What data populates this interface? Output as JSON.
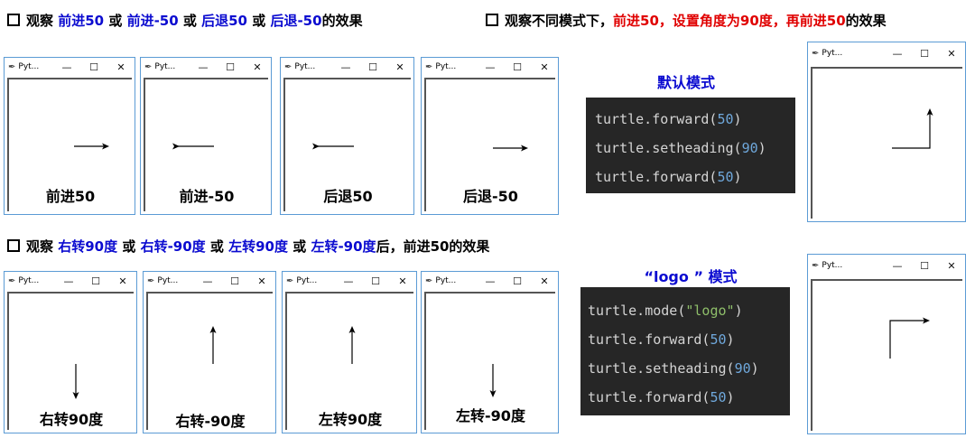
{
  "headings": {
    "h1": [
      "观察 ",
      "前进50",
      " 或 ",
      "前进-50",
      " 或 ",
      "后退50",
      " 或 ",
      "后退-50",
      "的效果"
    ],
    "h2": [
      "观察不同模式下，",
      "前进50，设置角度为90度，再前进50",
      "的效果"
    ],
    "h3": [
      "观察 ",
      "右转90度",
      " 或 ",
      "右转-90度",
      " 或 ",
      "左转90度",
      " 或 ",
      "左转-90度",
      "后，前进50的效果"
    ]
  },
  "window": {
    "title": "Pyt...",
    "minimize": "—",
    "maximize": "☐",
    "close": "✕",
    "icon": "feather-icon"
  },
  "captions_row1": [
    "前进50",
    "前进-50",
    "后退50",
    "后退-50"
  ],
  "captions_row2": [
    "右转90度",
    "右转-90度",
    "左转90度",
    "左转-90度"
  ],
  "default_mode": {
    "title": "默认模式",
    "code": [
      [
        "turtle.forward(",
        "50",
        ")"
      ],
      [
        "turtle.setheading(",
        "90",
        ")"
      ],
      [
        "turtle.forward(",
        "50",
        ")"
      ]
    ]
  },
  "logo_mode": {
    "title": "“logo ” 模式",
    "code_line1": [
      "turtle.mode(",
      "\"logo\"",
      ")"
    ],
    "code": [
      [
        "turtle.forward(",
        "50",
        ")"
      ],
      [
        "turtle.setheading(",
        "90",
        ")"
      ],
      [
        "turtle.forward(",
        "50",
        ")"
      ]
    ]
  },
  "colors": {
    "blue": "#0b0bd0",
    "red": "#e00000",
    "window_border": "#5b9bd5",
    "code_bg": "#262626",
    "number": "#6fa8dc",
    "string": "#8fbf6a"
  }
}
